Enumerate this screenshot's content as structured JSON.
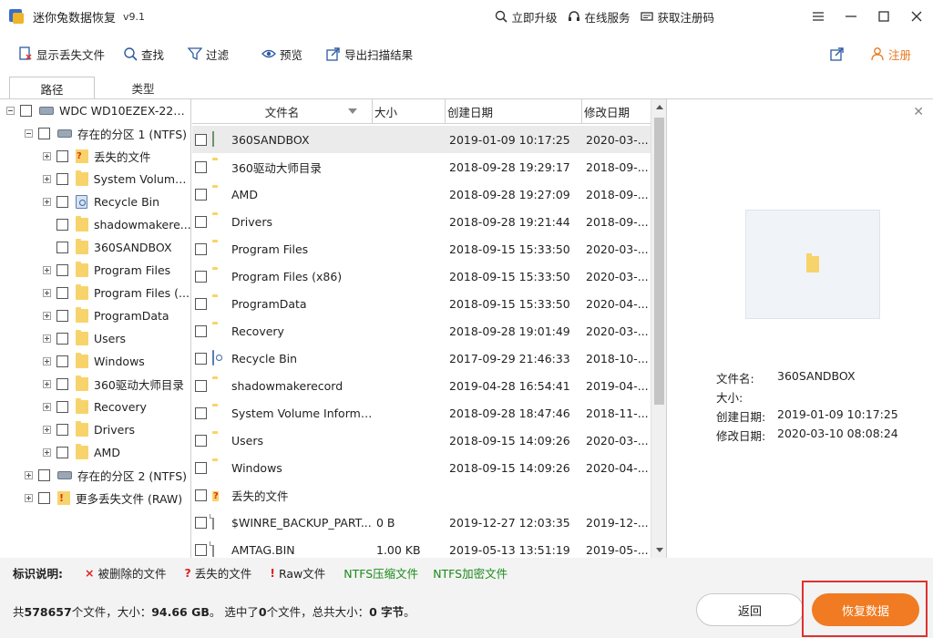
{
  "app": {
    "title": "迷你兔数据恢复",
    "version": "v9.1"
  },
  "title_actions": [
    {
      "label": "立即升级",
      "icon": "upgrade-icon"
    },
    {
      "label": "在线服务",
      "icon": "service-icon"
    },
    {
      "label": "获取注册码",
      "icon": "key-icon"
    }
  ],
  "toolbar": {
    "show_lost": "显示丢失文件",
    "find": "查找",
    "filter": "过滤",
    "preview": "预览",
    "export": "导出扫描结果",
    "register": "注册"
  },
  "tabs": [
    "路径",
    "类型"
  ],
  "tree": [
    {
      "label": "WDC WD10EZEX-22B...",
      "indent": 0,
      "expander": "minus",
      "icon": "disk"
    },
    {
      "label": "存在的分区 1 (NTFS)",
      "indent": 1,
      "expander": "minus",
      "icon": "disk"
    },
    {
      "label": "丢失的文件",
      "indent": 2,
      "expander": "plus",
      "icon": "lost"
    },
    {
      "label": "System Volume ...",
      "indent": 2,
      "expander": "plus",
      "icon": "folder"
    },
    {
      "label": "Recycle Bin",
      "indent": 2,
      "expander": "plus",
      "icon": "recycle"
    },
    {
      "label": "shadowmakere...",
      "indent": 2,
      "expander": "none",
      "icon": "folder"
    },
    {
      "label": "360SANDBOX",
      "indent": 2,
      "expander": "none",
      "icon": "folder"
    },
    {
      "label": "Program Files",
      "indent": 2,
      "expander": "plus",
      "icon": "folder"
    },
    {
      "label": "Program Files (...",
      "indent": 2,
      "expander": "plus",
      "icon": "folder"
    },
    {
      "label": "ProgramData",
      "indent": 2,
      "expander": "plus",
      "icon": "folder"
    },
    {
      "label": "Users",
      "indent": 2,
      "expander": "plus",
      "icon": "folder"
    },
    {
      "label": "Windows",
      "indent": 2,
      "expander": "plus",
      "icon": "folder"
    },
    {
      "label": "360驱动大师目录",
      "indent": 2,
      "expander": "plus",
      "icon": "folder"
    },
    {
      "label": "Recovery",
      "indent": 2,
      "expander": "plus",
      "icon": "folder"
    },
    {
      "label": "Drivers",
      "indent": 2,
      "expander": "plus",
      "icon": "folder"
    },
    {
      "label": "AMD",
      "indent": 2,
      "expander": "plus",
      "icon": "folder"
    },
    {
      "label": "存在的分区 2 (NTFS)",
      "indent": 1,
      "expander": "plus",
      "icon": "disk"
    },
    {
      "label": "更多丢失文件 (RAW)",
      "indent": 1,
      "expander": "plus",
      "icon": "raw"
    }
  ],
  "columns": {
    "name": "文件名",
    "size": "大小",
    "created": "创建日期",
    "modified": "修改日期"
  },
  "files": [
    {
      "name": "360SANDBOX",
      "size": "",
      "created": "2019-01-09 10:17:25",
      "modified": "2020-03-...",
      "icon": "sandbox",
      "selected": true
    },
    {
      "name": "360驱动大师目录",
      "size": "",
      "created": "2018-09-28 19:29:17",
      "modified": "2018-09-...",
      "icon": "folder"
    },
    {
      "name": "AMD",
      "size": "",
      "created": "2018-09-28 19:27:09",
      "modified": "2018-09-...",
      "icon": "folder"
    },
    {
      "name": "Drivers",
      "size": "",
      "created": "2018-09-28 19:21:44",
      "modified": "2018-09-...",
      "icon": "folder"
    },
    {
      "name": "Program Files",
      "size": "",
      "created": "2018-09-15 15:33:50",
      "modified": "2020-03-...",
      "icon": "folder"
    },
    {
      "name": "Program Files (x86)",
      "size": "",
      "created": "2018-09-15 15:33:50",
      "modified": "2020-03-...",
      "icon": "folder"
    },
    {
      "name": "ProgramData",
      "size": "",
      "created": "2018-09-15 15:33:50",
      "modified": "2020-04-...",
      "icon": "folder"
    },
    {
      "name": "Recovery",
      "size": "",
      "created": "2018-09-28 19:01:49",
      "modified": "2020-03-...",
      "icon": "folder"
    },
    {
      "name": "Recycle Bin",
      "size": "",
      "created": "2017-09-29 21:46:33",
      "modified": "2018-10-...",
      "icon": "recycle"
    },
    {
      "name": "shadowmakerecord",
      "size": "",
      "created": "2019-04-28 16:54:41",
      "modified": "2019-04-...",
      "icon": "folder"
    },
    {
      "name": "System Volume Information",
      "size": "",
      "created": "2018-09-28 18:47:46",
      "modified": "2018-11-...",
      "icon": "folder"
    },
    {
      "name": "Users",
      "size": "",
      "created": "2018-09-15 14:09:26",
      "modified": "2020-03-...",
      "icon": "folder"
    },
    {
      "name": "Windows",
      "size": "",
      "created": "2018-09-15 14:09:26",
      "modified": "2020-04-...",
      "icon": "folder"
    },
    {
      "name": "丢失的文件",
      "size": "",
      "created": "",
      "modified": "",
      "icon": "lost"
    },
    {
      "name": "$WINRE_BACKUP_PART...",
      "size": "0 B",
      "created": "2019-12-27 12:03:35",
      "modified": "2019-12-...",
      "icon": "file"
    },
    {
      "name": "AMTAG.BIN",
      "size": "1.00 KB",
      "created": "2019-05-13 13:51:19",
      "modified": "2019-05-...",
      "icon": "file"
    }
  ],
  "preview": {
    "name_label": "文件名:",
    "name_value": "360SANDBOX",
    "size_label": "大小:",
    "size_value": "",
    "created_label": "创建日期:",
    "created_value": "2019-01-09 10:17:25",
    "modified_label": "修改日期:",
    "modified_value": "2020-03-10 08:08:24"
  },
  "legend": {
    "label": "标识说明:",
    "deleted": "被删除的文件",
    "lost": "丢失的文件",
    "raw": "Raw文件",
    "ntfs_compressed": "NTFS压缩文件",
    "ntfs_encrypted": "NTFS加密文件"
  },
  "status": {
    "p1": "共",
    "total_files": "578657",
    "p2": "个文件，大小：",
    "total_size": "94.66 GB",
    "p3": "。 选中了",
    "selected_count": "0",
    "p4": "个文件，总共大小：",
    "selected_size": "0 字节",
    "p5": "。"
  },
  "buttons": {
    "back": "返回",
    "recover": "恢复数据"
  },
  "colors": {
    "accent": "#f07b22",
    "highlight": "#e03030",
    "ntfs_green": "#1a8a1a"
  }
}
